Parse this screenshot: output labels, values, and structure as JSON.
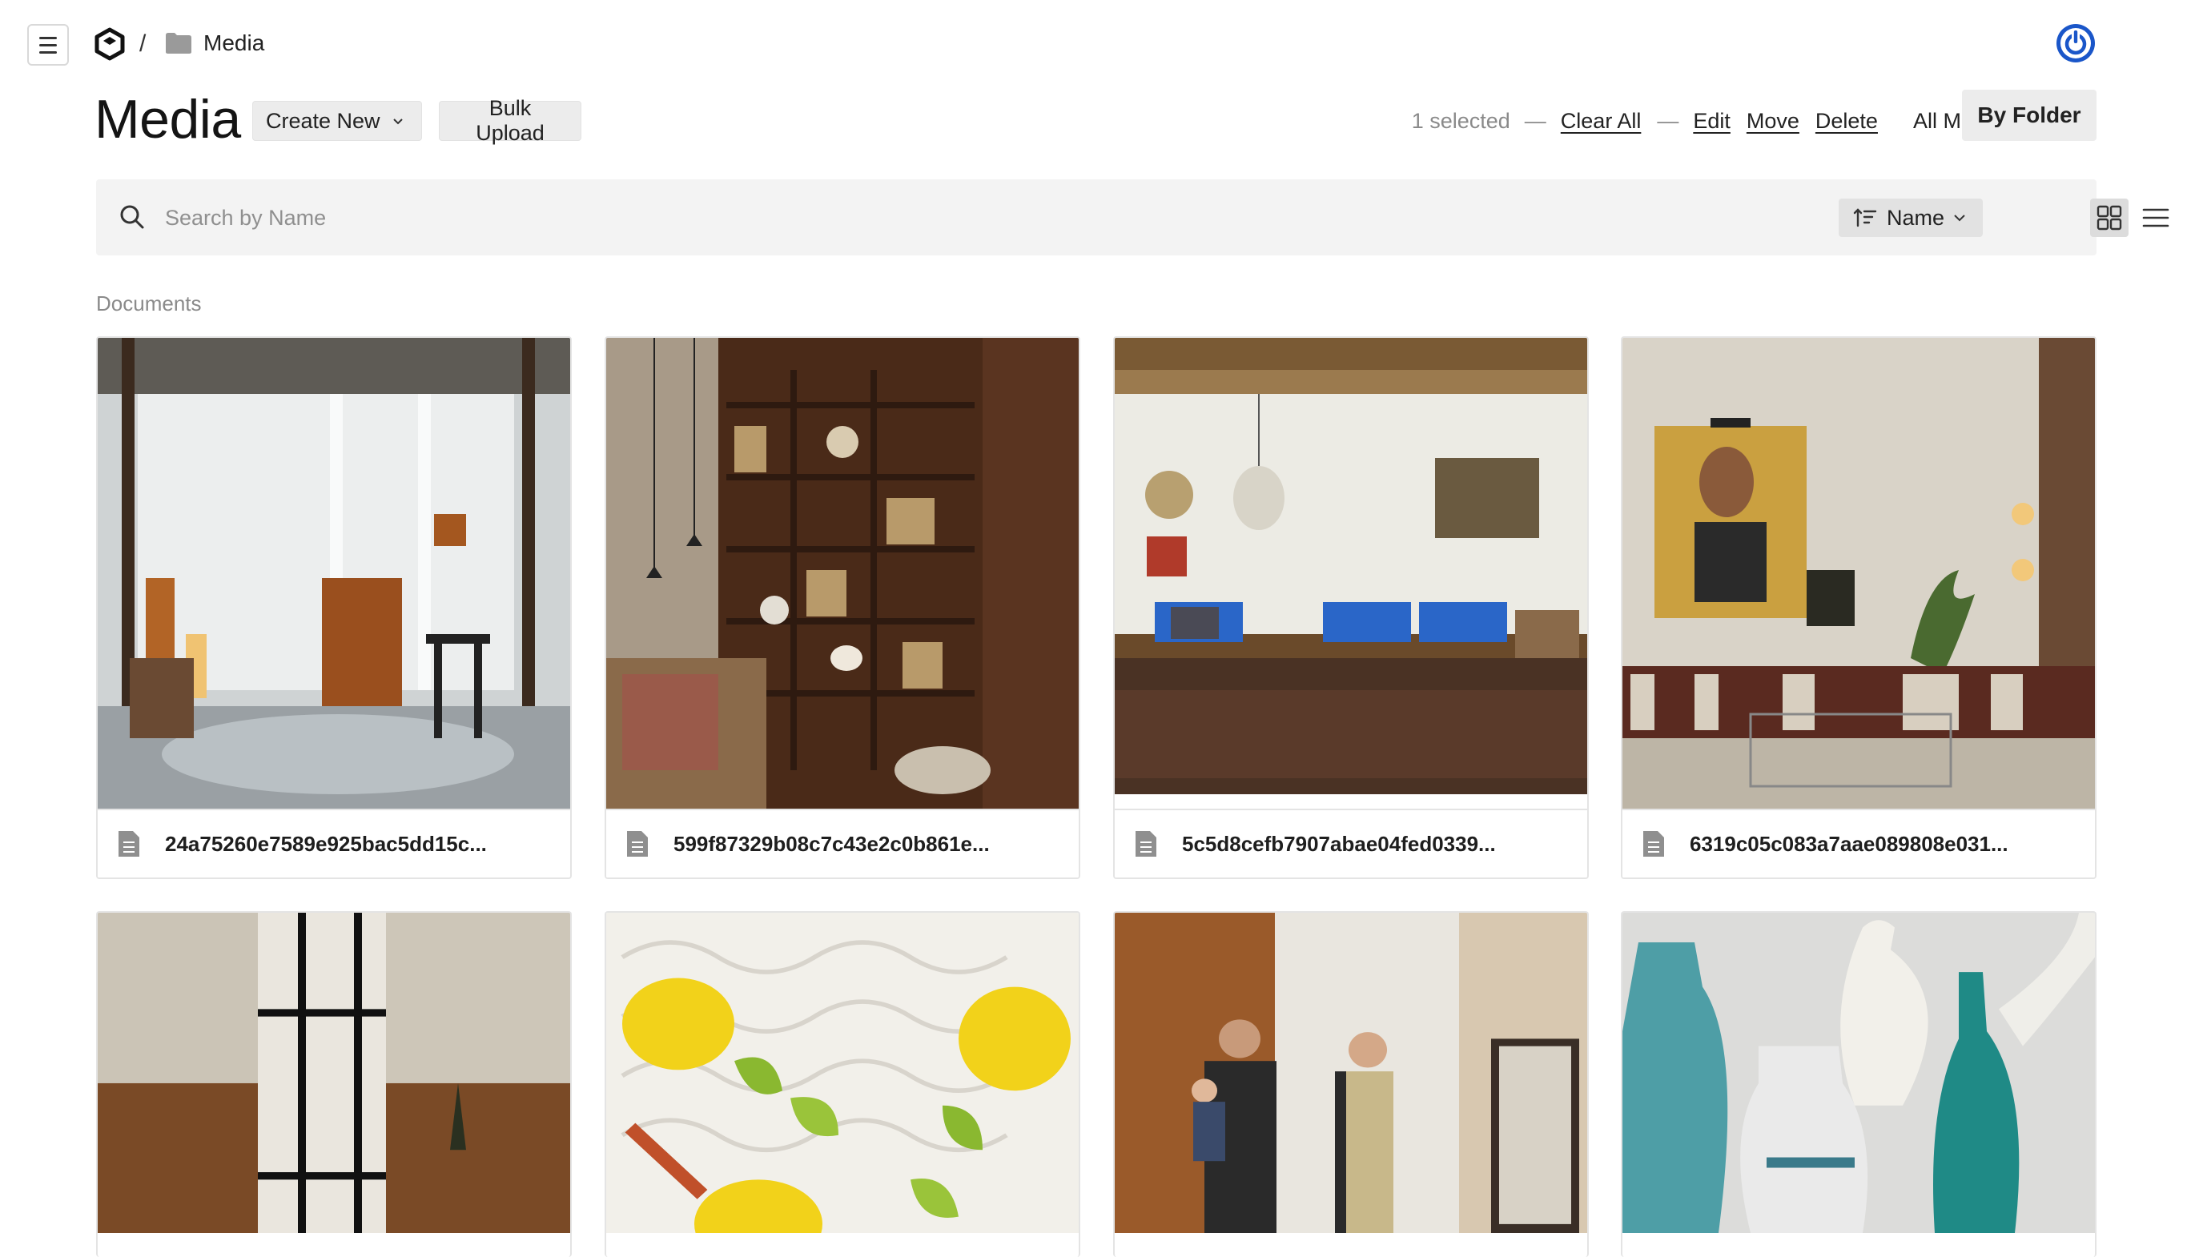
{
  "breadcrumb": {
    "separator": "/",
    "folder_icon": "folder-icon",
    "current": "Media"
  },
  "header": {
    "title": "Media",
    "create_new_label": "Create New",
    "bulk_upload_label": "Bulk Upload"
  },
  "selection": {
    "count_text": "1 selected",
    "separator": "—",
    "clear_all": "Clear All",
    "edit": "Edit",
    "move": "Move",
    "delete": "Delete"
  },
  "views": {
    "all_media": "All Media",
    "by_folder": "By Folder"
  },
  "search": {
    "placeholder": "Search by Name",
    "sort_label": "Name"
  },
  "section": {
    "label": "Documents"
  },
  "files": [
    {
      "name": "24a75260e7589e925bac5dd15c...",
      "image": "curtains-room"
    },
    {
      "name": "599f87329b08c7c43e2c0b861e...",
      "image": "bookshelf-room"
    },
    {
      "name": "5c5d8cefb7907abae04fed0339...",
      "image": "blue-sofa-room"
    },
    {
      "name": "6319c05c083a7aae089808e031...",
      "image": "portrait-room"
    },
    {
      "name": "",
      "image": "linen-curtains"
    },
    {
      "name": "",
      "image": "lemon-ceramic"
    },
    {
      "name": "",
      "image": "family-portrait"
    },
    {
      "name": "",
      "image": "ceramic-vases"
    }
  ],
  "colors": {
    "accent": "#1a56c9",
    "button_bg": "#ececec",
    "search_bg": "#f3f3f3"
  }
}
